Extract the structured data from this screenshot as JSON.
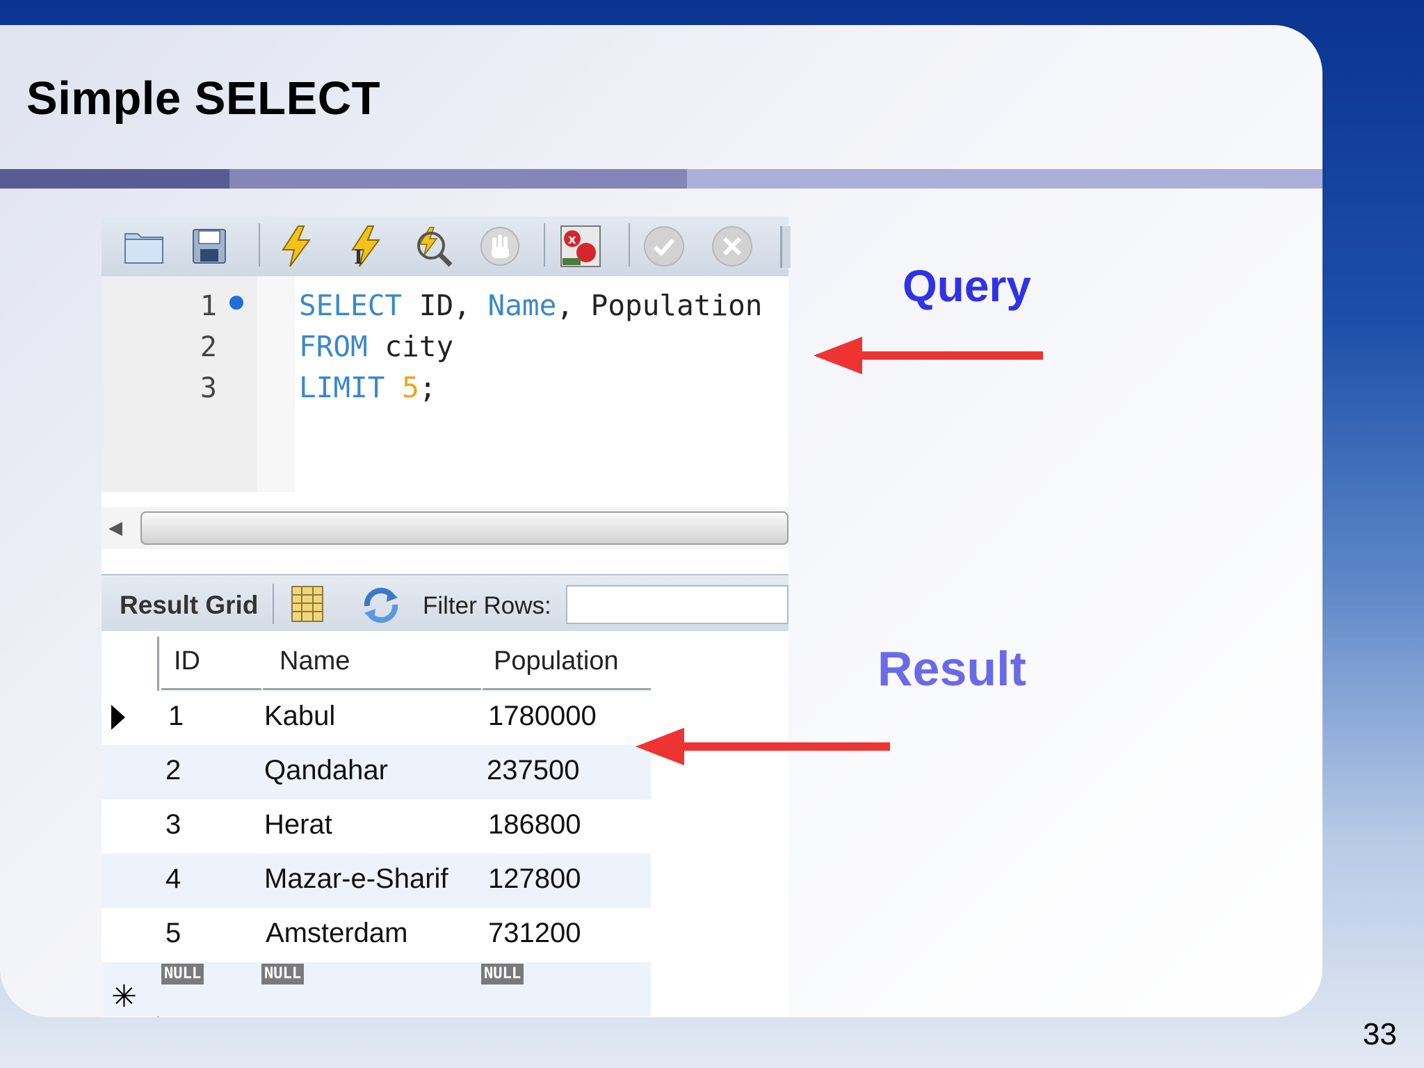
{
  "slide": {
    "title": "Simple SELECT",
    "page_number": "33"
  },
  "labels": {
    "query": "Query",
    "result": "Result"
  },
  "editor": {
    "line_numbers": [
      "1",
      "2",
      "3"
    ],
    "lines": [
      {
        "kw1": "SELECT",
        "t1": " ID, ",
        "kw2": "Name",
        "t2": ", Population"
      },
      {
        "kw1": "FROM",
        "t1": " city"
      },
      {
        "kw1": "LIMIT",
        "num": "5",
        "t1": ";"
      }
    ]
  },
  "toolbar_icons": [
    "open-folder-icon",
    "save-icon",
    "execute-lightning-icon",
    "execute-current-icon",
    "explain-magnifier-icon",
    "stop-hand-icon",
    "toggle-error-icon",
    "commit-check-icon",
    "rollback-x-icon"
  ],
  "result_toolbar": {
    "tab": "Result Grid",
    "filter_label": "Filter Rows:",
    "filter_value": ""
  },
  "grid": {
    "headers": [
      "ID",
      "Name",
      "Population"
    ],
    "rows": [
      [
        "1",
        "Kabul",
        "1780000"
      ],
      [
        "2",
        "Qandahar",
        "237500"
      ],
      [
        "3",
        "Herat",
        "186800"
      ],
      [
        "4",
        "Mazar-e-Sharif",
        "127800"
      ],
      [
        "5",
        "Amsterdam",
        "731200"
      ]
    ],
    "null_label": "NULL"
  },
  "colors": {
    "arrow": "#ee3333",
    "query_label": "#3131e6",
    "result_label": "#6a6ae8"
  }
}
